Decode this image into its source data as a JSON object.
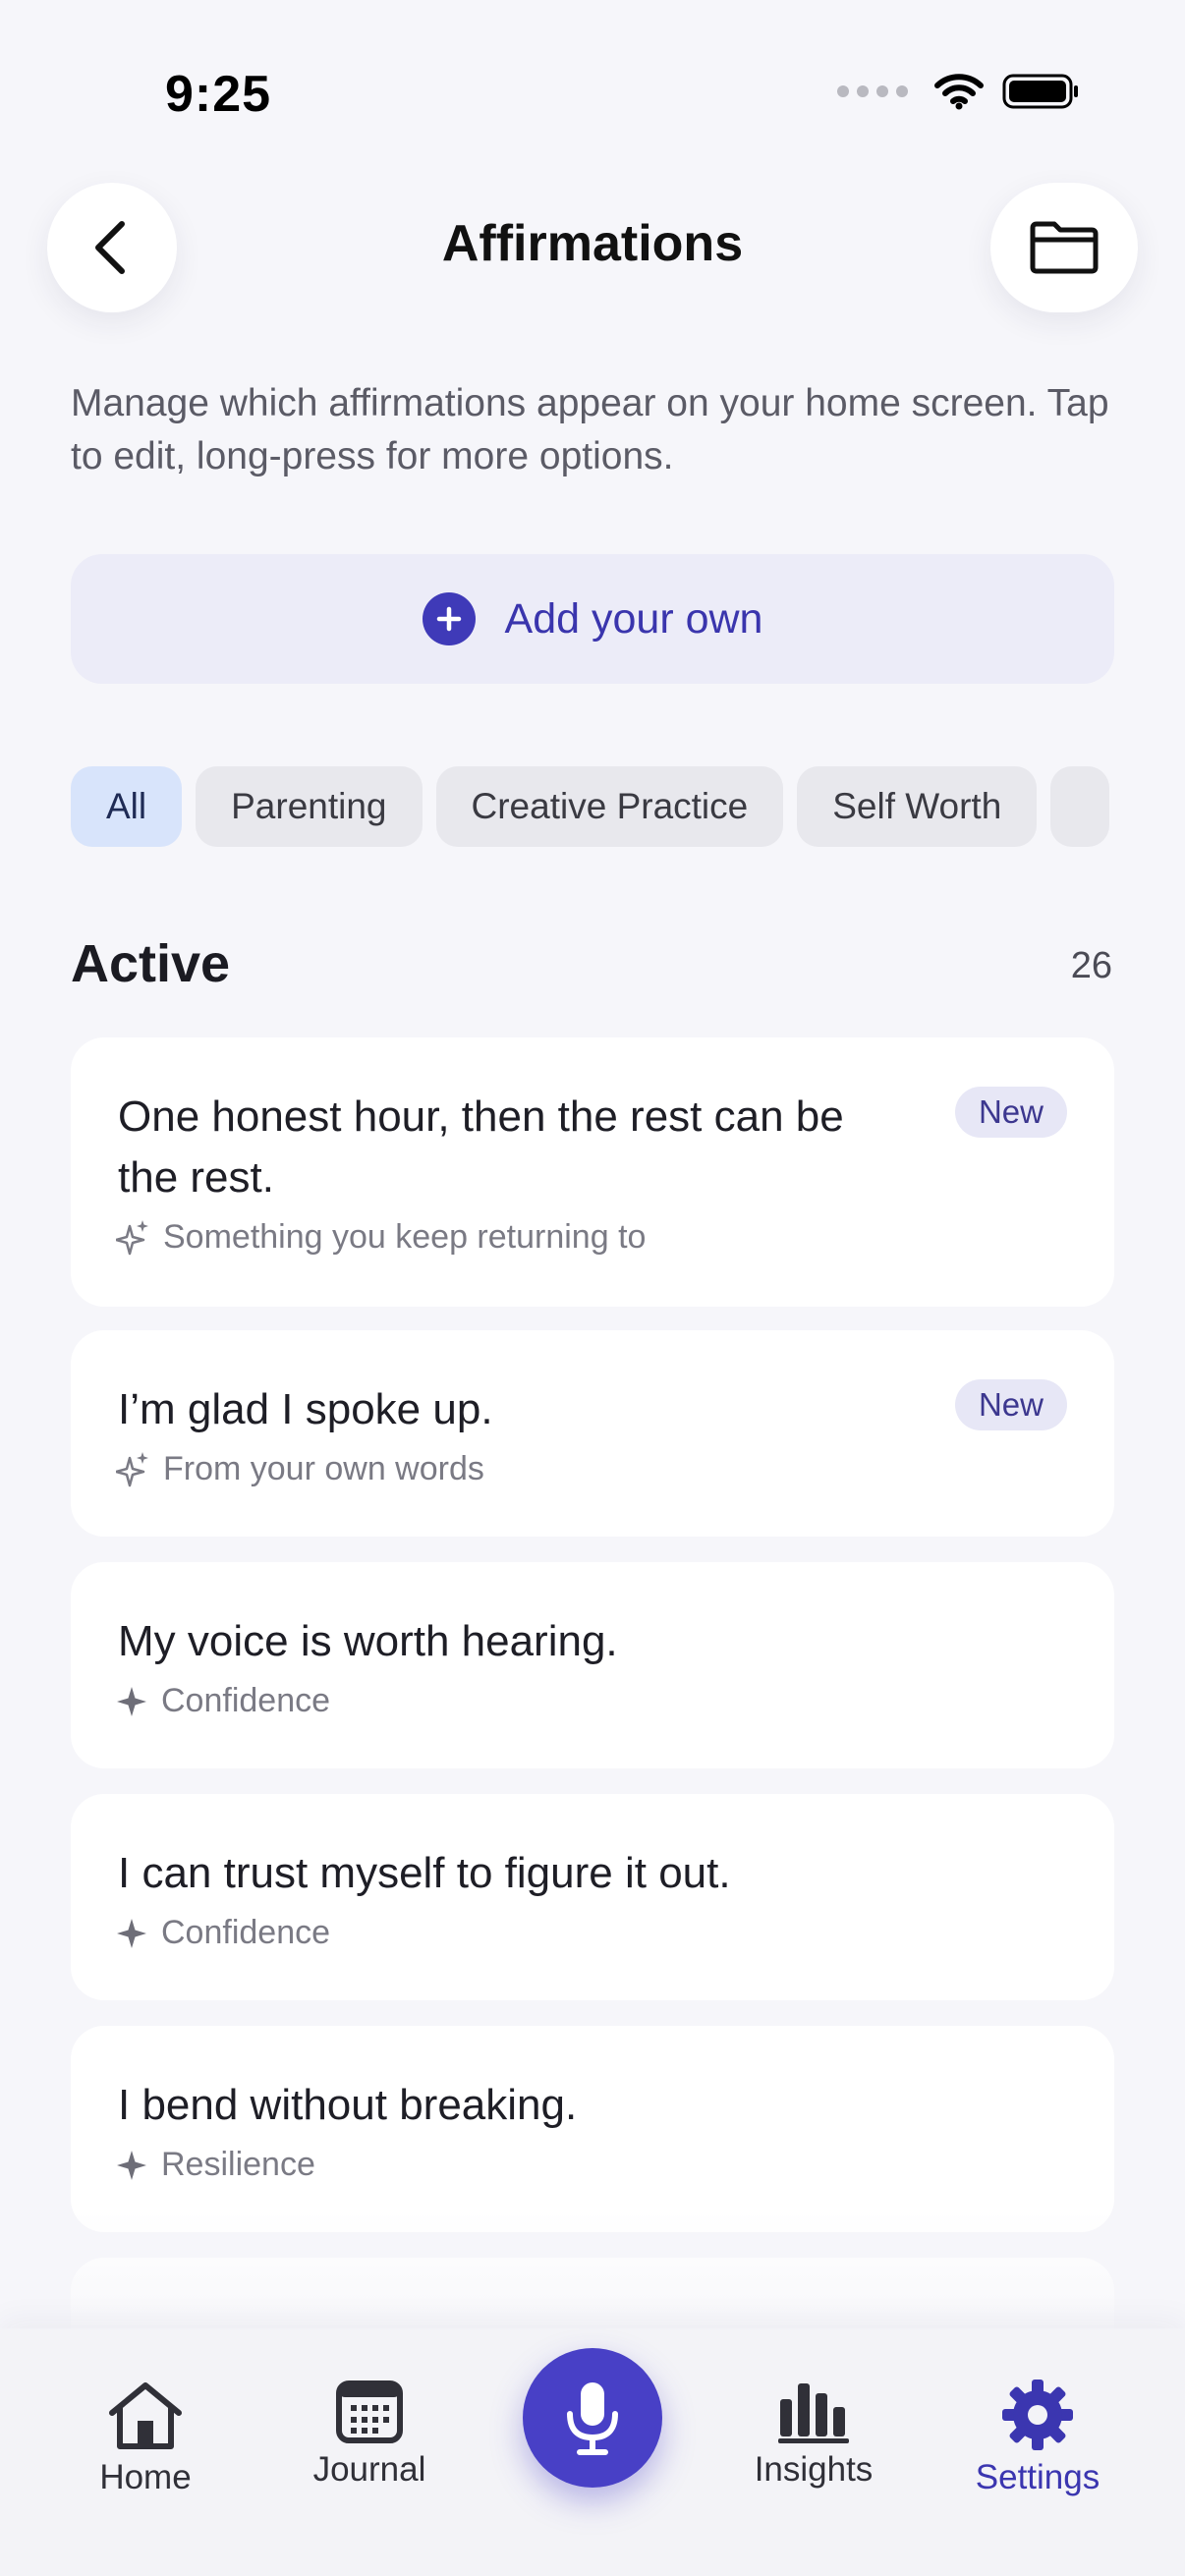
{
  "status_bar": {
    "time": "9:25"
  },
  "header": {
    "title": "Affirmations",
    "back_icon": "chevron-left-icon",
    "folder_icon": "folder-icon"
  },
  "description": "Manage which affirmations appear on your home screen. Tap to edit, long-press for more options.",
  "add_button": {
    "label": "Add your own"
  },
  "filters": [
    "All",
    "Parenting",
    "Creative Practice",
    "Self Worth"
  ],
  "active_filter": "All",
  "section": {
    "title": "Active",
    "count": "26"
  },
  "affirmations": [
    {
      "text": "One honest hour, then the rest can be the rest.",
      "source": "Something you keep returning to",
      "badge": "New",
      "icon": "sparkles-icon"
    },
    {
      "text": "I’m glad I spoke up.",
      "source": "From your own words",
      "badge": "New",
      "icon": "sparkles-icon"
    },
    {
      "text": "My voice is worth hearing.",
      "source": "Confidence",
      "icon": "sparkle-icon"
    },
    {
      "text": "I can trust myself to figure it out.",
      "source": "Confidence",
      "icon": "sparkle-icon"
    },
    {
      "text": "I bend without breaking.",
      "source": "Resilience",
      "icon": "sparkle-icon"
    }
  ],
  "tabbar": {
    "tabs": [
      {
        "label": "Home",
        "icon": "home-icon"
      },
      {
        "label": "Journal",
        "icon": "calendar-icon"
      },
      {
        "label": "Insights",
        "icon": "bar-chart-icon"
      },
      {
        "label": "Settings",
        "icon": "gear-icon"
      }
    ],
    "selected": "Settings",
    "center_icon": "microphone-icon"
  },
  "colors": {
    "accent": "#4840c6",
    "background": "#f6f6fa",
    "badge_bg": "#e7e7f6"
  }
}
